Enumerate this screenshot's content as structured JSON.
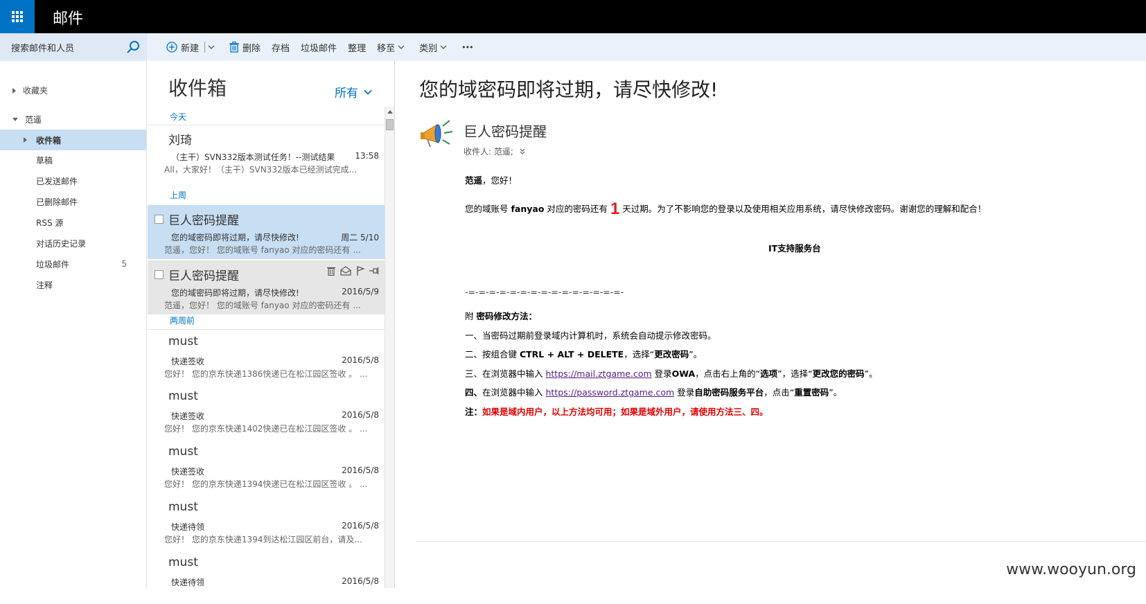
{
  "app": {
    "title": "邮件"
  },
  "search": {
    "placeholder": "搜索邮件和人员"
  },
  "toolbar": {
    "new_label": "新建",
    "delete_label": "删除",
    "archive_label": "存档",
    "junk_label": "垃圾邮件",
    "sweep_label": "整理",
    "move_label": "移至",
    "categories_label": "类别",
    "more_label": "•••"
  },
  "nav": {
    "favorites_label": "收藏夹",
    "account_label": "范遥",
    "folders": [
      {
        "label": "收件箱",
        "selected": true
      },
      {
        "label": "草稿"
      },
      {
        "label": "已发送邮件"
      },
      {
        "label": "已删除邮件"
      },
      {
        "label": "RSS 源"
      },
      {
        "label": "对话历史记录"
      },
      {
        "label": "垃圾邮件",
        "count": "5"
      },
      {
        "label": "注释"
      }
    ]
  },
  "list": {
    "title": "收件箱",
    "filter": "所有",
    "groups": {
      "today": "今天",
      "last_week": "上周",
      "two_weeks": "两周前"
    },
    "messages": [
      {
        "from": "刘琦",
        "subject": "（主干）SVN332版本测试任务！--测试结果",
        "date": "13:58",
        "preview": "All，大家好！（主干）SVN332版本已经测试完成..."
      },
      {
        "from": "巨人密码提醒",
        "subject": "您的域密码即将过期，请尽快修改!",
        "date": "周二 5/10",
        "preview": "范遥，您好！  您的域账号 fanyao 对应的密码还有 ..."
      },
      {
        "from": "巨人密码提醒",
        "subject": "您的域密码即将过期，请尽快修改!",
        "date": "2016/5/9",
        "preview": "范遥，您好！  您的域账号 fanyao 对应的密码还有 ..."
      },
      {
        "from": "must",
        "subject": "快递签收",
        "date": "2016/5/8",
        "preview": "您好！ 您的京东快递1386快递已在松江园区签收 。 ..."
      },
      {
        "from": "must",
        "subject": "快递签收",
        "date": "2016/5/8",
        "preview": "您好！ 您的京东快递1402快递已在松江园区签收 。 ..."
      },
      {
        "from": "must",
        "subject": "快递签收",
        "date": "2016/5/8",
        "preview": "您好！ 您的京东快递1394快递已在松江园区签收 。 ..."
      },
      {
        "from": "must",
        "subject": "快递待领",
        "date": "2016/5/8",
        "preview": "您好！ 您的京东快递1394到达松江园区前台，请及..."
      },
      {
        "from": "must",
        "subject": "快递待领",
        "date": "2016/5/8",
        "preview": ""
      }
    ]
  },
  "reading": {
    "subject": "您的域密码即将过期，请尽快修改!",
    "sender": "巨人密码提醒",
    "recipients_label": "收件人:",
    "recipients": "范遥;",
    "greeting": "范遥",
    "greeting_rest": "，您好！",
    "line1_a": "您的域账号 ",
    "line1_account": "fanyao",
    "line1_b": " 对应的密码还有 ",
    "line1_days": "1",
    "line1_c": " 天过期。为了不影响您的登录以及使用相关应用系统，请尽快修改密码。谢谢您的理解和配合！",
    "signature": "IT支持服务台",
    "divider": "-=-=-=-=-=-=-=-=-=-=-=-=-=-=-=-",
    "method_prefix": "附 ",
    "method_title": "密码修改方法：",
    "step1": "一、当密码过期前登录域内计算机时，系统会自动提示修改密码。",
    "step2_a": "二、按组合键 ",
    "step2_keys": "CTRL + ALT + DELETE",
    "step2_b": "，选择“",
    "step2_c": "更改密码",
    "step2_d": "”。",
    "step3_a": "三、在浏览器中输入 ",
    "step3_link": "https://mail.ztgame.com",
    "step3_b": " 登录",
    "step3_c": "OWA",
    "step3_d": "，点击右上角的“",
    "step3_e": "选项",
    "step3_f": "”，选择“",
    "step3_g": "更改您的密码",
    "step3_h": "”。",
    "step4_a": "四、",
    "step4_b": "在浏览器中输入 ",
    "step4_link": "https://password.ztgame.com",
    "step4_c": " 登录",
    "step4_d": "自助密码服务平台",
    "step4_e": "，点击“",
    "step4_f": "重置密码",
    "step4_g": "”。",
    "note_prefix": "注：",
    "note": "如果是域内用户，以上方法均可用；如果是域外用户，请使用方法三、四。"
  },
  "watermark": "www.wooyun.org",
  "colors": {
    "accent": "#0072c6",
    "selected": "#c7def3",
    "topbar": "#000000",
    "warning": "#e00000"
  }
}
